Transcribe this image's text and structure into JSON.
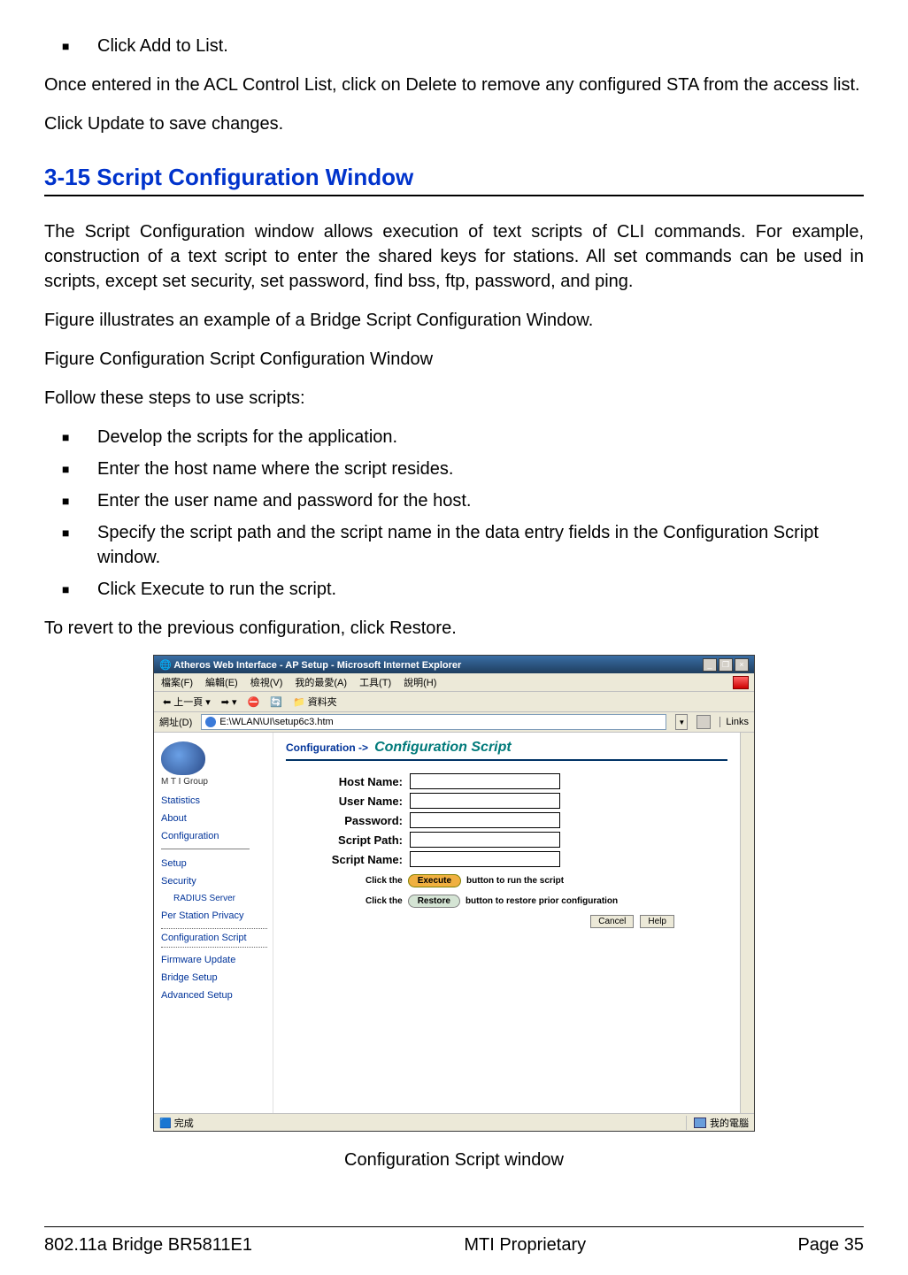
{
  "body": {
    "top_bullet": "Click Add to List.",
    "para1": "Once entered in the ACL Control List, click on Delete to remove any configured STA from the access list.",
    "para2": "Click Update to save changes.",
    "heading": "3-15 Script Configuration Window",
    "para3": "The Script Configuration window allows execution of text scripts of CLI commands. For example, construction of a text script to enter the shared keys for stations. All set commands can be used in scripts, except set security, set password, find bss, ftp, password, and ping.",
    "para4": "Figure illustrates an example of a Bridge Script Configuration Window.",
    "para5": "Figure Configuration Script Configuration Window",
    "para6": "Follow these steps to use scripts:",
    "bullets": [
      "Develop the scripts for the application.",
      "Enter the host name where the script resides.",
      "Enter the user name and password for the host.",
      "Specify the script path and the script name in the data entry fields in the Configuration Script window.",
      "Click Execute to run the script."
    ],
    "para7": "To revert to the previous configuration, click Restore.",
    "caption": "Configuration Script window"
  },
  "browser": {
    "title": "Atheros Web Interface - AP Setup - Microsoft Internet Explorer",
    "menubar": [
      "檔案(F)",
      "編輯(E)",
      "檢視(V)",
      "我的最愛(A)",
      "工具(T)",
      "說明(H)"
    ],
    "toolbar": {
      "back": "上一頁",
      "folders": "資料夾"
    },
    "address_label": "網址(D)",
    "address_value": "E:\\WLAN\\UI\\setup6c3.htm",
    "links_label": "Links",
    "sidebar": {
      "brand": "M T I  Group",
      "items": [
        "Statistics",
        "About",
        "Configuration"
      ],
      "sub_items": [
        "Setup",
        "Security"
      ],
      "radius": "RADIUS Server",
      "rest": [
        "Per Station Privacy",
        "Configuration Script",
        "Firmware Update",
        "Bridge Setup",
        "Advanced Setup"
      ]
    },
    "main": {
      "crumb_prefix": "Configuration ->",
      "crumb_title": "Configuration Script",
      "labels": {
        "host": "Host Name:",
        "user": "User Name:",
        "pass": "Password:",
        "spath": "Script Path:",
        "sname": "Script Name:"
      },
      "exec_pre": "Click the",
      "exec_btn": "Execute",
      "exec_post": "button to run the script",
      "restore_btn": "Restore",
      "restore_post": "button to restore prior configuration",
      "cancel": "Cancel",
      "help": "Help"
    },
    "status_done": "完成",
    "status_zone": "我的電腦"
  },
  "footer": {
    "left": "802.11a Bridge BR5811E1",
    "center": "MTI Proprietary",
    "right": "Page 35"
  }
}
